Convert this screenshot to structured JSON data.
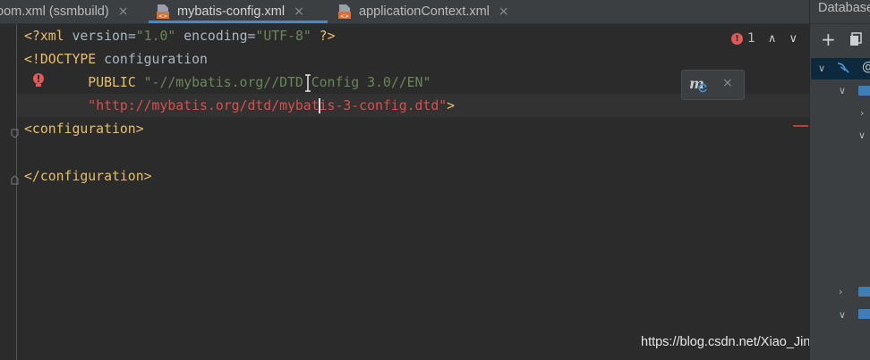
{
  "tabs": [
    {
      "label": "pom.xml (ssmbuild)",
      "visible_label": "oom.xml (ssmbuild)",
      "active": false
    },
    {
      "label": "mybatis-config.xml",
      "active": true
    },
    {
      "label": "applicationContext.xml",
      "active": false
    }
  ],
  "tab_close_glyph": "×",
  "code": {
    "line1": {
      "open": "<?xml",
      "attr1": " version",
      "eq1": "=",
      "val1": "\"1.0\"",
      "attr2": " encoding",
      "eq2": "=",
      "val2": "\"UTF-8\"",
      "close": " ?>"
    },
    "line2": {
      "open": "<!DOCTYPE",
      "name": " configuration"
    },
    "line3": {
      "indent": "        ",
      "public": "PUBLIC",
      "sp": " ",
      "value": "\"-//mybatis.org//DTD Config 3.0//EN\""
    },
    "line4": {
      "indent": "        ",
      "url": "\"http://mybatis.org/dtd/mybatis-3-config.dtd\"",
      "close": ">"
    },
    "line5": "<configuration>",
    "line7": "</configuration>"
  },
  "inspection": {
    "error_count": "1",
    "up": "∧",
    "down": "∨"
  },
  "maven_popup": {
    "icon_letter": "m",
    "close": "×"
  },
  "db_panel": {
    "title": "Database",
    "add": "+",
    "root_label": "@"
  },
  "watermark": "https://blog.csdn.net/Xiao_Jin_Ling",
  "colors": {
    "editor_bg": "#2b2b2b",
    "tag": "#e8bf6a",
    "string": "#6a8759",
    "url": "#d94f4f",
    "keyword": "#cc7832",
    "accent": "#4a88c7",
    "error": "#e05a5a"
  }
}
